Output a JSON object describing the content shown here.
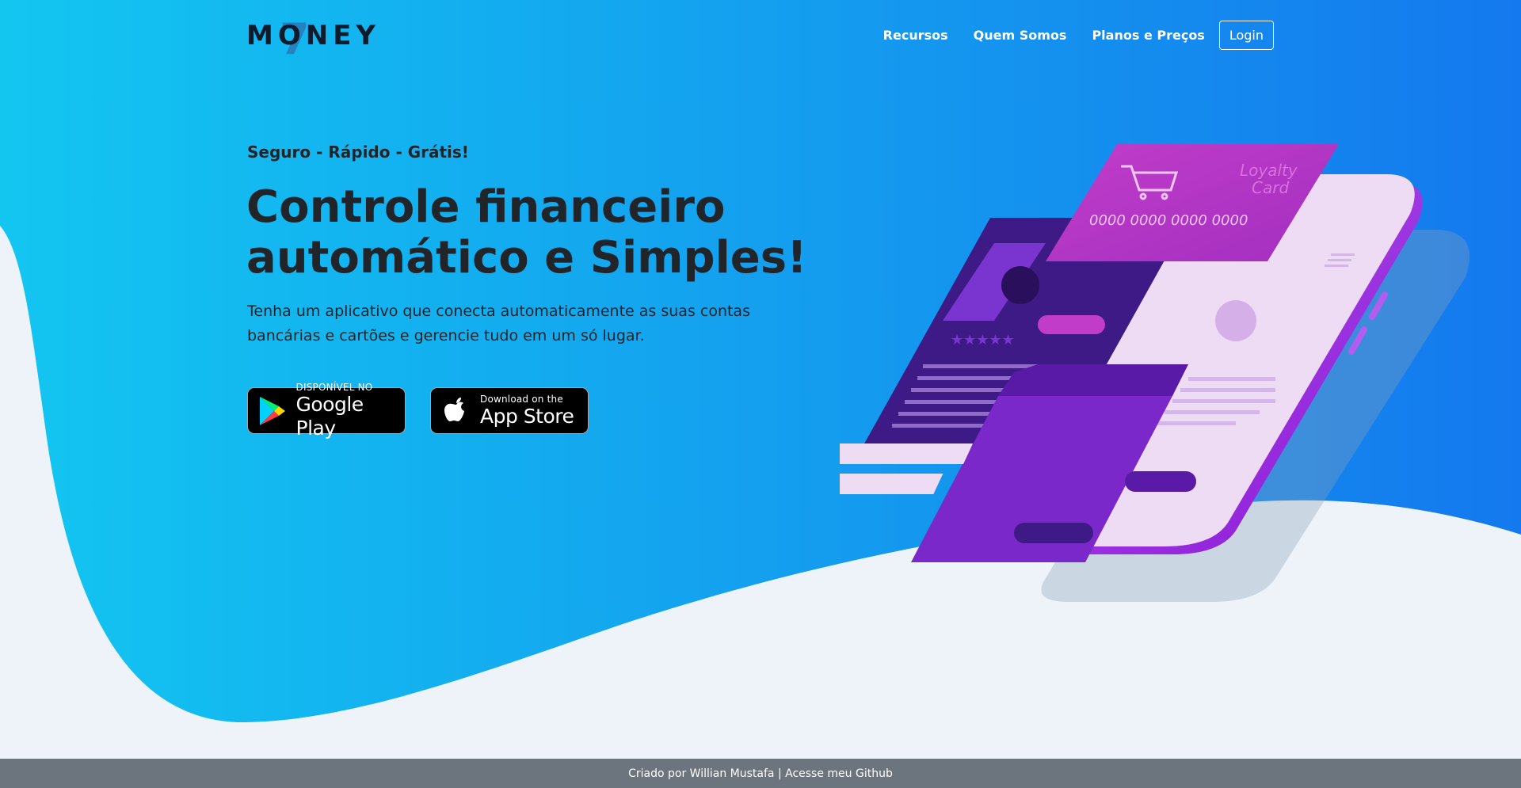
{
  "brand": {
    "logo_text": "MONEY",
    "logo_mark": "7"
  },
  "nav": {
    "links": [
      "Recursos",
      "Quem Somos",
      "Planos e Preços"
    ],
    "login_label": "Login"
  },
  "hero": {
    "tagline": "Seguro - Rápido - Grátis!",
    "headline_line1": "Controle financeiro",
    "headline_line2": "automático e Simples!",
    "description": "Tenha um aplicativo que conecta automaticamente as suas contas bancárias e cartões e gerencie tudo em um só lugar."
  },
  "stores": {
    "google": {
      "small": "DISPONÍVEL NO",
      "big": "Google Play"
    },
    "apple": {
      "small": "Download on the",
      "big": "App Store"
    }
  },
  "illustration": {
    "card_number": "0000 0000 0000 0000",
    "card_label_1": "Loyalty",
    "card_label_2": "Card"
  },
  "footer": {
    "text": "Criado por Willian Mustafa | Acesse meu Github"
  },
  "colors": {
    "gradient_start": "#13c6f0",
    "gradient_end": "#1479ee",
    "page_bg": "#eef3fa",
    "footer_bg": "#6c757d",
    "text_dark": "#212529"
  }
}
